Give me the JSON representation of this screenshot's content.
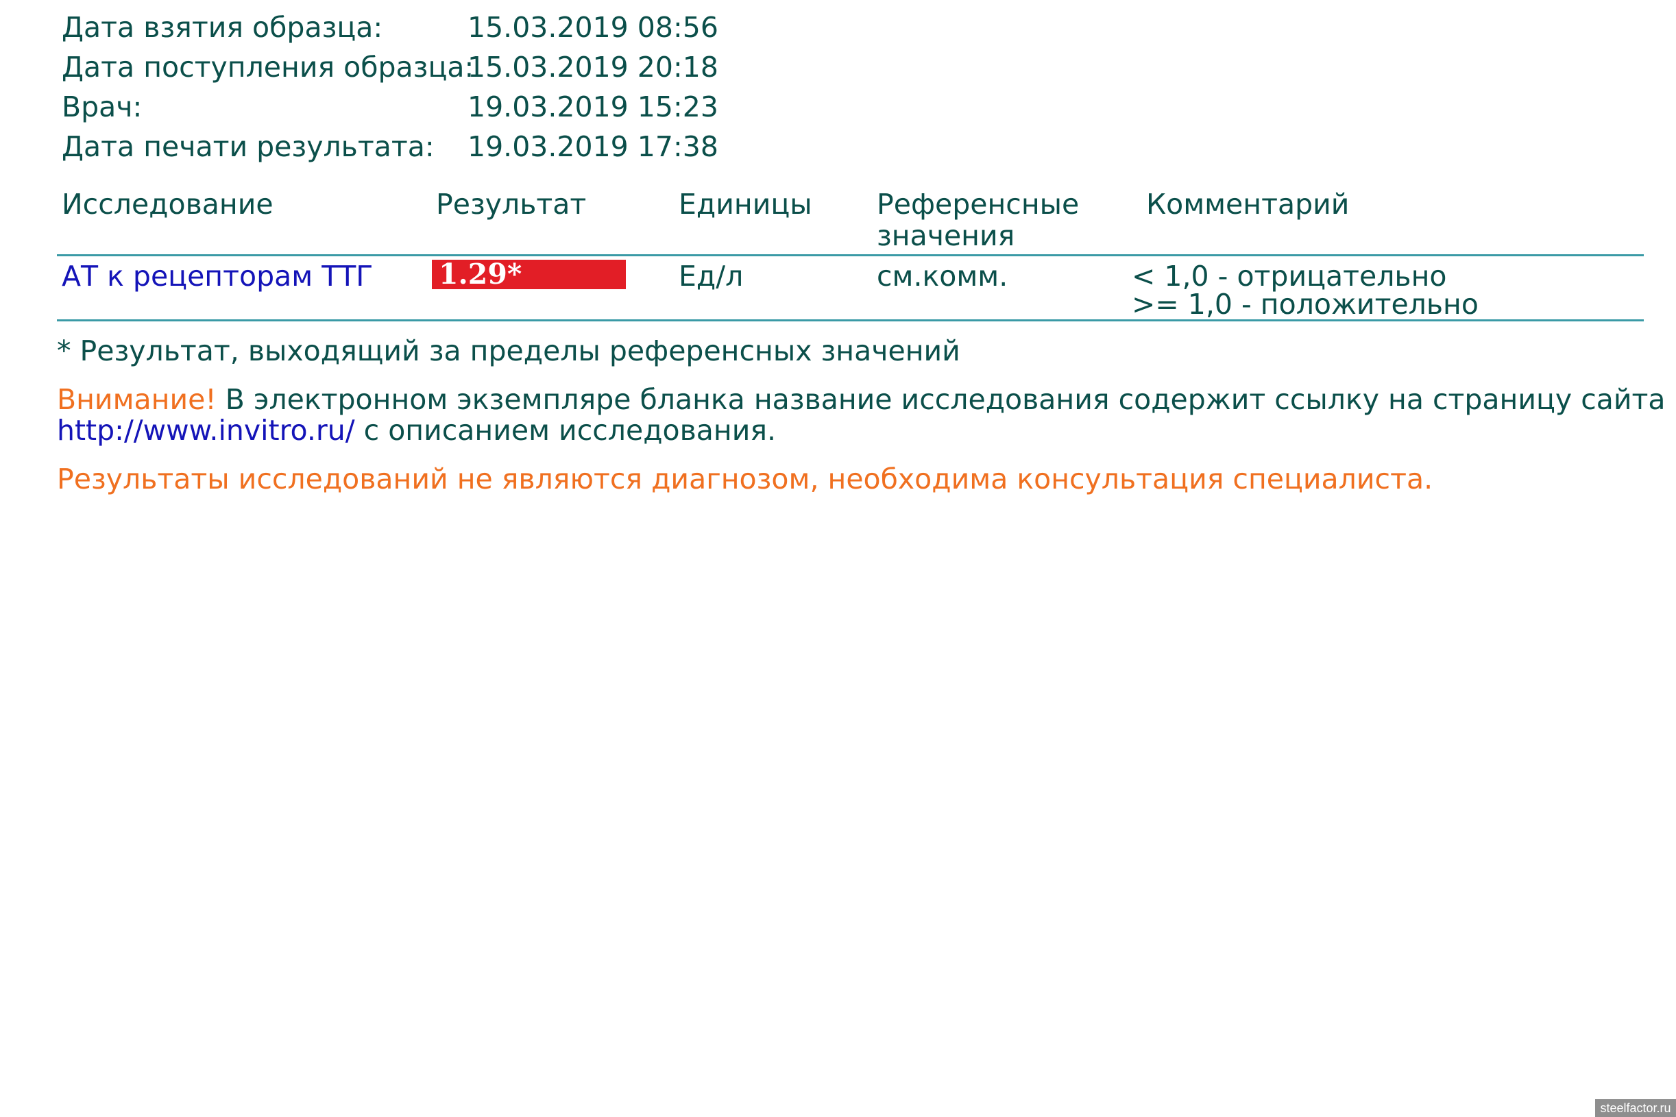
{
  "meta": [
    {
      "label": "Дата взятия образца:",
      "value": "15.03.2019 08:56"
    },
    {
      "label": "Дата поступления образца:",
      "value": "15.03.2019 20:18"
    },
    {
      "label": "Врач:",
      "value": "19.03.2019 15:23"
    },
    {
      "label": "Дата печати результата:",
      "value": "19.03.2019 17:38"
    }
  ],
  "table": {
    "headers": {
      "study": "Исследование",
      "result": "Результат",
      "units": "Единицы",
      "reference_line1": "Референсные",
      "reference_line2": "значения",
      "comment": "Комментарий"
    },
    "rows": [
      {
        "study": "АТ к рецепторам ТТГ",
        "result": "1.29*",
        "units": "Ед/л",
        "reference": "см.комм.",
        "comment_line1": "< 1,0 - отрицательно",
        "comment_line2": ">= 1,0 - положительно"
      }
    ]
  },
  "footnote": "* Результат, выходящий за пределы референсных значений",
  "attention": {
    "label": "Внимание!",
    "text": " В электронном экземпляре бланка название исследования содержит ссылку на страницу сайта",
    "link": "http://www.invitro.ru/",
    "text_after": " с описанием исследования."
  },
  "disclaimer": "Результаты исследований не являются диагнозом, необходима консультация специалиста.",
  "watermark": "steelfactor.ru",
  "colors": {
    "text": "#0b4f4a",
    "link": "#1414b8",
    "warning": "#f07020",
    "result_flag": "#e21e26",
    "rule": "#3a9aa6"
  }
}
